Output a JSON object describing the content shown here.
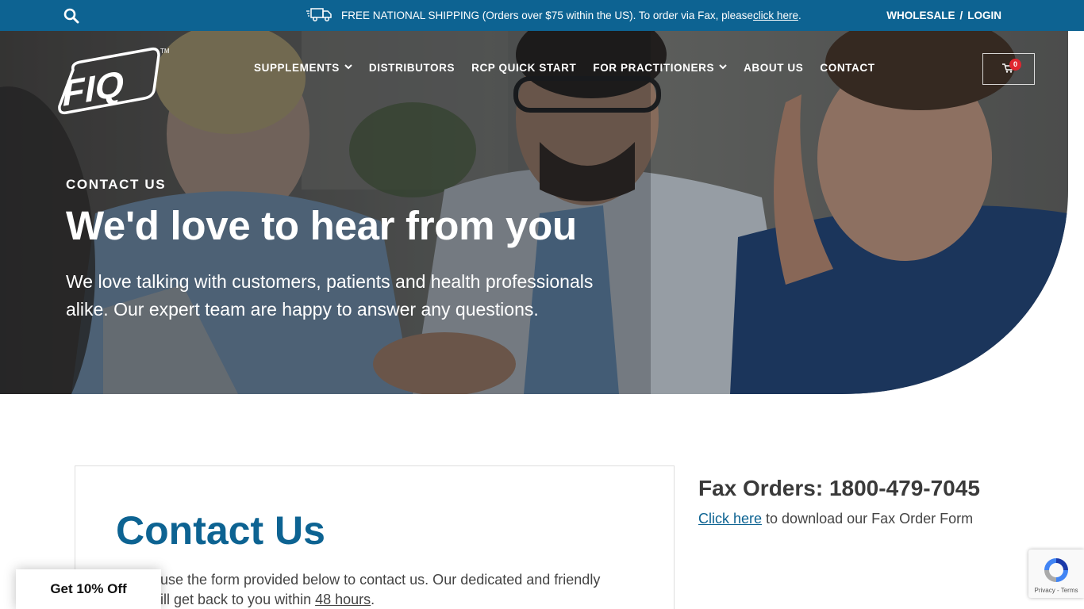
{
  "topbar": {
    "shipping_text": "FREE NATIONAL SHIPPING (Orders over $75 within the US). To order via Fax, please ",
    "shipping_link": "click here",
    "shipping_end": ".",
    "wholesale": "WHOLESALE",
    "separator": "/",
    "login": "LOGIN"
  },
  "brand": {
    "logo_text": "FIQ",
    "trademark": "TM"
  },
  "nav": {
    "items": [
      {
        "label": "SUPPLEMENTS",
        "dropdown": true
      },
      {
        "label": "DISTRIBUTORS",
        "dropdown": false
      },
      {
        "label": "RCP QUICK START",
        "dropdown": false
      },
      {
        "label": "FOR PRACTITIONERS",
        "dropdown": true
      },
      {
        "label": "ABOUT US",
        "dropdown": false
      },
      {
        "label": "CONTACT",
        "dropdown": false
      }
    ],
    "chevron": "❯"
  },
  "cart": {
    "count": "0",
    "icon": "cart-icon"
  },
  "hero": {
    "eyebrow": "CONTACT US",
    "headline": "We'd love to hear from you",
    "subtext": "We love talking with customers, patients and health professionals alike. Our expert team are happy to answer any questions."
  },
  "contact": {
    "title": "Contact Us",
    "line1": "use the form provided below to contact us. Our dedicated and friendly",
    "line2_pre": "ill get back to you within ",
    "line2_link": "48 hours",
    "line2_post": "."
  },
  "fax": {
    "title": "Fax Orders: 1800-479-7045",
    "link": "Click here",
    "text": " to download our Fax Order Form"
  },
  "promo": {
    "label": "Get 10% Off"
  },
  "recaptcha": {
    "text": "Privacy - Terms"
  },
  "colors": {
    "brand_blue": "#0d6392",
    "badge_red": "#e0262f"
  }
}
